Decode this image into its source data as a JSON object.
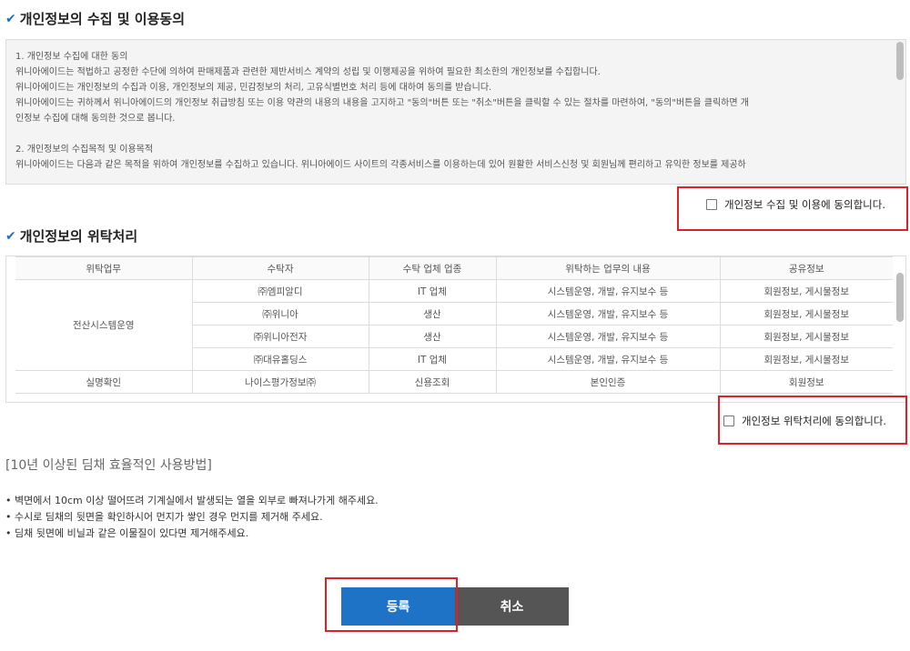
{
  "privacy_consent": {
    "title": "개인정보의 수집 및 이용동의",
    "terms_lines": [
      "1. 개인정보 수집에 대한 동의",
      "위니아에이드는 적법하고 공정한 수단에 의하여 판매제품과 관련한 제반서비스 계약의 성립 및 이행제공을 위하여 필요한 최소한의 개인정보를 수집합니다.",
      "위니아에이드는 개인정보의 수집과 이용, 개인정보의 제공, 민감정보의 처리, 고유식별번호 처리 등에 대하여 동의를 받습니다.",
      "위니아에이드는 귀하께서 위니아에이드의 개인정보 취급방침 또는 이용 약관의 내용의 내용을 고지하고 \"동의\"버튼 또는 \"취소\"버튼을 클릭할 수 있는 절차를 마련하여, \"동의\"버튼을 클릭하면 개",
      "인정보 수집에 대해 동의한 것으로 봅니다.",
      "",
      "2. 개인정보의 수집목적 및 이용목적",
      "위니아에이드는 다음과 같은 목적을 위하여 개인정보를 수집하고 있습니다. 위니아에이드 사이트의 각종서비스를 이용하는데 있어 원활한 서비스신청 및 회원님께 편리하고 유익한 정보를 제공하"
    ],
    "agree_label": "개인정보 수집 및 이용에 동의합니다."
  },
  "entrust": {
    "title": "개인정보의 위탁처리",
    "columns": [
      "위탁업무",
      "수탁자",
      "수탁 업체 업종",
      "위탁하는 업무의 내용",
      "공유정보"
    ],
    "group1": "전산시스템운영",
    "rows": [
      {
        "company": "㈜엠피알디",
        "industry": "IT 업체",
        "work": "시스템운영, 개발, 유지보수 등",
        "shared": "회원정보, 게시물정보"
      },
      {
        "company": "㈜위니아",
        "industry": "생산",
        "work": "시스템운영, 개발, 유지보수 등",
        "shared": "회원정보, 게시물정보"
      },
      {
        "company": "㈜위니아전자",
        "industry": "생산",
        "work": "시스템운영, 개발, 유지보수 등",
        "shared": "회원정보, 게시물정보"
      },
      {
        "company": "㈜대유홀딩스",
        "industry": "IT 업체",
        "work": "시스템운영, 개발, 유지보수 등",
        "shared": "회원정보, 게시물정보"
      }
    ],
    "row_last": {
      "task": "실명확인",
      "company": "나이스평가정보㈜",
      "industry": "신용조회",
      "work": "본인인증",
      "shared": "회원정보"
    },
    "agree_label": "개인정보 위탁처리에 동의합니다."
  },
  "usage": {
    "title": "[10년 이상된 딤채 효율적인 사용방법]",
    "items": [
      "벽면에서 10cm 이상 떨어뜨려 기계실에서 발생되는 열을 외부로 빠져나가게 해주세요.",
      "수시로 딤채의 뒷면을 확인하시어 먼지가 쌓인 경우 먼지를 제거해 주세요.",
      "딤채 뒷면에 비닐과 같은 이물질이 있다면 제거해주세요."
    ]
  },
  "buttons": {
    "submit": "등록",
    "cancel": "취소"
  },
  "colors": {
    "accent": "#1f73c7",
    "highlight": "#e01f26",
    "cancel_bg": "#555555"
  }
}
